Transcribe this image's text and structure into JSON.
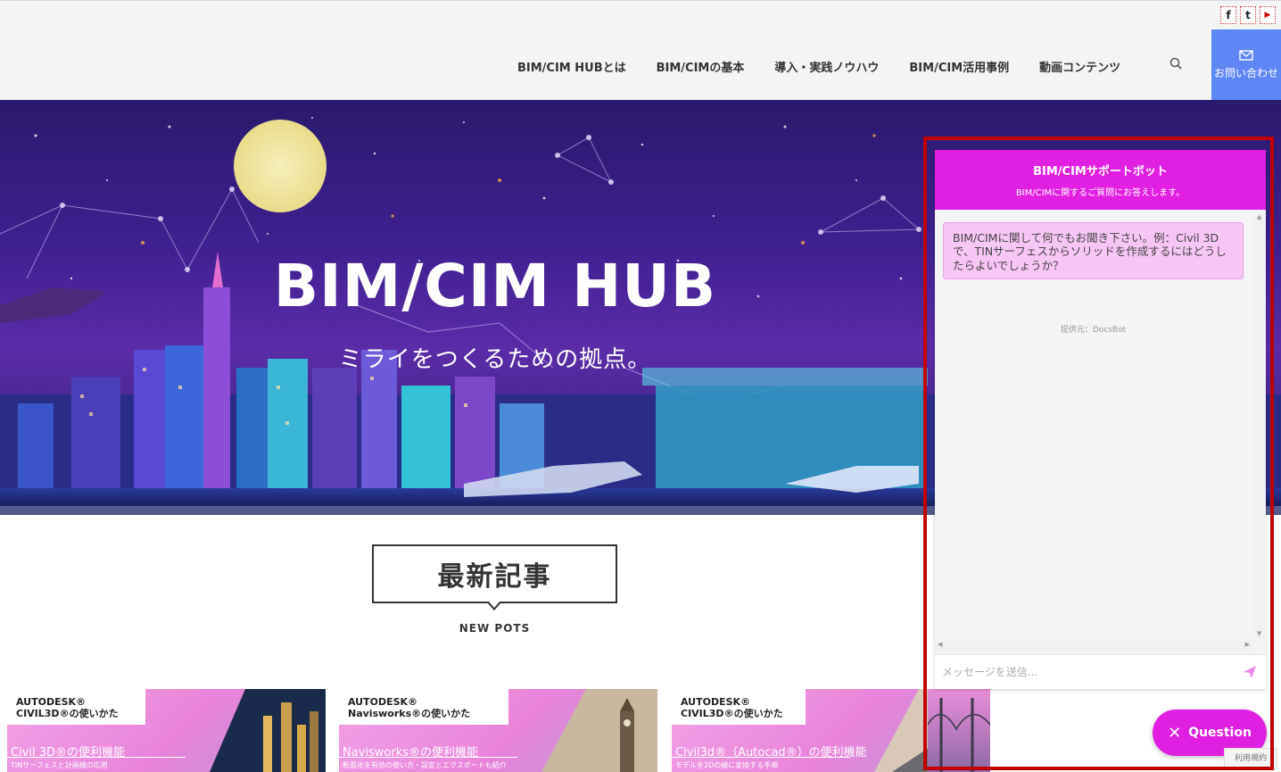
{
  "header": {
    "social": [
      "f",
      "t",
      "▶"
    ],
    "nav": [
      "BIM/CIM HUBとは",
      "BIM/CIMの基本",
      "導入・実践ノウハウ",
      "BIM/CIM活用事例",
      "動画コンテンツ"
    ],
    "contact_label": "お問い合わせ"
  },
  "hero": {
    "title": "BIM/CIM HUB",
    "subtitle": "ミライをつくるための拠点。"
  },
  "latest": {
    "title": "最新記事",
    "subtitle": "NEW POTS"
  },
  "cards": [
    {
      "brand1": "AUTODESK®",
      "brand2": "CIVIL3D®の使いかた",
      "feature": "Civil 3D®の便利機能",
      "sub": "TINサーフェスと計画線の応用"
    },
    {
      "brand1": "AUTODESK®",
      "brand2": "Navisworks®の使いかた",
      "feature": "Navisworks®の便利機能",
      "sub": "断面化を有効の使い方・設定とエクスポートも紹介"
    },
    {
      "brand1": "AUTODESK®",
      "brand2": "CIVIL3D®の使いかた",
      "feature": "Civil3d®（Autocad®）の便利機能",
      "sub": "モデルを2Dの線に変換する手順"
    }
  ],
  "chatbot": {
    "title": "BIM/CIMサポートボット",
    "subtitle": "BIM/CIMに関するご質問にお答えします。",
    "message": "BIM/CIMに関して何でもお聞き下さい。例：Civil 3Dで、TINサーフェスからソリッドを作成するにはどうしたらよいでしょうか？",
    "powered_by": "提供元：DocsBot",
    "input_placeholder": "メッセージを送信...",
    "question_button": "Question"
  },
  "recaptcha_text": "利用規約",
  "colors": {
    "accent_magenta": "#e01fe0",
    "contact_blue": "#5c87f5",
    "highlight_red": "#c00000"
  }
}
